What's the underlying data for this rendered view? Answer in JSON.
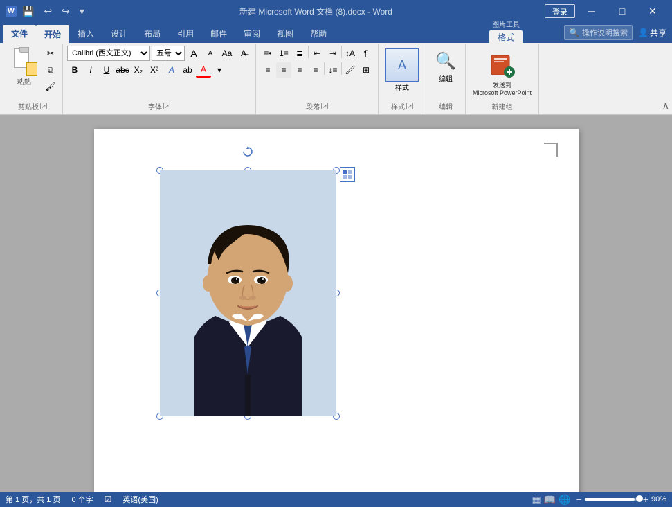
{
  "titleBar": {
    "title": "新建 Microsoft Word 文档 (8).docx - Word",
    "loginLabel": "登录",
    "minimizeIcon": "─",
    "restoreIcon": "□",
    "closeIcon": "✕",
    "quickAccess": [
      "💾",
      "↩",
      "↪",
      "▾"
    ]
  },
  "ribbonTabs": [
    {
      "id": "file",
      "label": "文件",
      "active": false
    },
    {
      "id": "home",
      "label": "开始",
      "active": true
    },
    {
      "id": "insert",
      "label": "插入",
      "active": false
    },
    {
      "id": "design",
      "label": "设计",
      "active": false
    },
    {
      "id": "layout",
      "label": "布局",
      "active": false
    },
    {
      "id": "references",
      "label": "引用",
      "active": false
    },
    {
      "id": "mail",
      "label": "邮件",
      "active": false
    },
    {
      "id": "review",
      "label": "审阅",
      "active": false
    },
    {
      "id": "view",
      "label": "视图",
      "active": false
    },
    {
      "id": "help",
      "label": "帮助",
      "active": false
    },
    {
      "id": "picture",
      "label": "格式",
      "active": false,
      "pictureTools": true
    }
  ],
  "ribbon": {
    "groups": [
      {
        "id": "clipboard",
        "label": "剪贴板",
        "pasteLabel": "粘贴"
      },
      {
        "id": "font",
        "label": "字体",
        "fontName": "Calibri (西文正文)",
        "fontSize": "五号",
        "bold": "B",
        "italic": "I",
        "underline": "U"
      },
      {
        "id": "paragraph",
        "label": "段落"
      },
      {
        "id": "styles",
        "label": "样式",
        "buttonLabel": "样式"
      },
      {
        "id": "editing",
        "label": "编辑",
        "buttonLabel": "编辑"
      },
      {
        "id": "newgroup",
        "label": "新建组",
        "sendToPptLabel": "发送到\nMicrosoft PowerPoint"
      }
    ],
    "searchPlaceholder": "操作说明搜索",
    "shareLabel": "共享"
  },
  "document": {
    "page": "第 1 页，共 1 页",
    "wordCount": "0 个字",
    "language": "英语(美国)",
    "zoom": "90%"
  },
  "image": {
    "altText": "证件照 - 男青年正装照",
    "layoutIconLabel": "布局选项"
  },
  "pictureTools": {
    "tabLabel": "图片工具"
  }
}
